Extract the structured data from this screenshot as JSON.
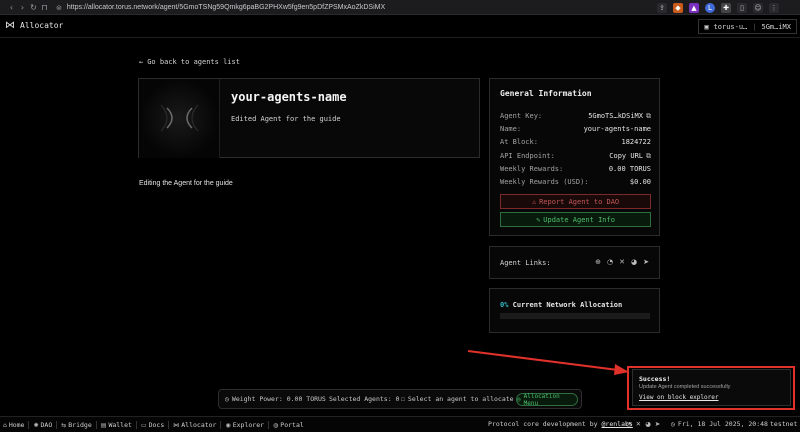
{
  "browser": {
    "url": "https://allocator.torus.network/agent/5GmoTSNg59Qmkg6paBG2PHXw5fg9en5pDfZPSMxAoZkDSiMX"
  },
  "app": {
    "name": "Allocator",
    "wallet_name": "torus-u…",
    "wallet_address": "5Gm…iMX"
  },
  "agent": {
    "back_label": "Go back to agents list",
    "name": "your-agents-name",
    "short_description": "Edited Agent for the guide",
    "body": "Editing the Agent for the guide"
  },
  "general_info": {
    "title": "General Information",
    "rows": [
      {
        "key": "Agent Key:",
        "value": "5GmoTS…kDSiMX",
        "copy": true
      },
      {
        "key": "Name:",
        "value": "your-agents-name",
        "copy": false
      },
      {
        "key": "At Block:",
        "value": "1824722",
        "copy": false
      },
      {
        "key": "API Endpoint:",
        "value": "Copy URL",
        "copy": true
      },
      {
        "key": "Weekly Rewards:",
        "value": "0.00 TORUS",
        "copy": false
      },
      {
        "key": "Weekly Rewards (USD):",
        "value": "$0.00",
        "copy": false
      }
    ],
    "report_label": "Report Agent to DAO",
    "update_label": "Update Agent Info"
  },
  "agent_links": {
    "label": "Agent Links:"
  },
  "network_allocation": {
    "percent_label": "0%",
    "label": "Current Network Allocation",
    "fraction": 0.0
  },
  "allocator_bar": {
    "weight_power": "Weight Power: 0.00 TORUS",
    "selected_agents": "Selected Agents: 0",
    "select_prompt": "Select an agent to allocate",
    "menu_label": "Allocation Menu"
  },
  "toast": {
    "title": "Success!",
    "message": "Update Agent completed successfully",
    "link": "View on block explorer"
  },
  "footer": {
    "nav": [
      {
        "label": "Home",
        "icon": "home-icon",
        "glyph": "⌂"
      },
      {
        "label": "DAO",
        "icon": "dao-icon",
        "glyph": "✺"
      },
      {
        "label": "Bridge",
        "icon": "bridge-icon",
        "glyph": "⇆"
      },
      {
        "label": "Wallet",
        "icon": "wallet-icon",
        "glyph": "▤"
      },
      {
        "label": "Docs",
        "icon": "docs-icon",
        "glyph": "▭"
      },
      {
        "label": "Allocator",
        "icon": "allocator-icon",
        "glyph": "⋈"
      },
      {
        "label": "Explorer",
        "icon": "explorer-icon",
        "glyph": "◉"
      },
      {
        "label": "Portal",
        "icon": "portal-icon",
        "glyph": "◍"
      }
    ],
    "credit_prefix": "Protocol core development by",
    "credit_link": "@renlabs",
    "date": "Fri, 18 Jul 2025, 20:48",
    "network": "testnet"
  },
  "colors": {
    "accent_cyan": "#35b8c8",
    "success_green": "#4fbf6d",
    "danger_red": "#c25757",
    "highlight_red": "#e0312b"
  }
}
